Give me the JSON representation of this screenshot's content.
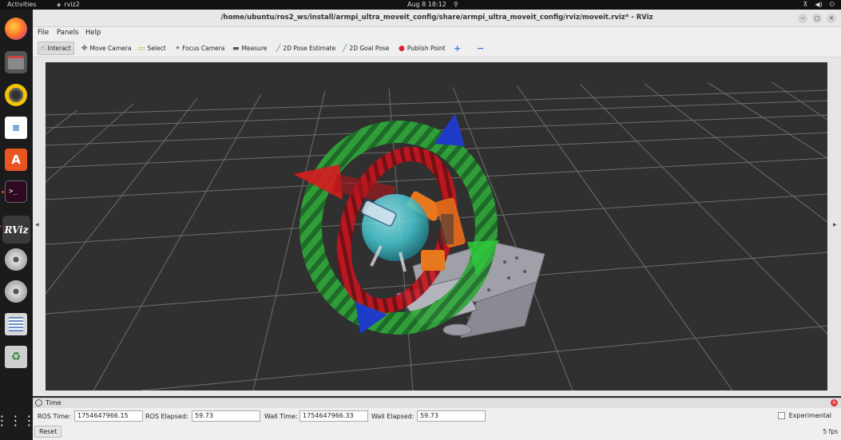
{
  "topbar": {
    "activities": "Activities",
    "app_name": "rviz2",
    "clock": "Aug 8  18:12"
  },
  "dock": {
    "writer_glyph": "≡",
    "appstore_glyph": "A",
    "terminal_glyph": ">_",
    "rviz_label": "RViz",
    "trash_glyph": "♻",
    "grid_glyph": "⋮⋮⋮"
  },
  "window": {
    "title": "/home/ubuntu/ros2_ws/install/armpi_ultra_moveit_config/share/armpi_ultra_moveit_config/rviz/moveit.rviz* - RViz"
  },
  "menu": {
    "file": "File",
    "panels": "Panels",
    "help": "Help"
  },
  "toolbar": {
    "interact": "Interact",
    "move_camera": "Move Camera",
    "select": "Select",
    "focus_camera": "Focus Camera",
    "measure": "Measure",
    "pose_estimate": "2D Pose Estimate",
    "goal_pose": "2D Goal Pose",
    "publish_point": "Publish Point",
    "add_tool": "+",
    "remove_tool": "−"
  },
  "time_panel": {
    "header": "Time",
    "ros_time_label": "ROS Time:",
    "ros_time": "1754647966.15",
    "ros_elapsed_label": "ROS Elapsed:",
    "ros_elapsed": "59.73",
    "wall_time_label": "Wall Time:",
    "wall_time": "1754647966.33",
    "wall_elapsed_label": "Wall Elapsed:",
    "wall_elapsed": "59.73",
    "experimental_label": "Experimental",
    "experimental_checked": false,
    "reset_label": "Reset",
    "fps": "5 fps"
  },
  "colors": {
    "viewport_bg": "#303030",
    "grid": "#6e6e6e",
    "ring_green": "#2fa83a",
    "ring_red": "#c8141e",
    "arrow_red": "#d21e1e",
    "arrow_blue": "#1e3cc8",
    "arm_orange": "#e8781e",
    "sphere_cyan": "#46c8d2",
    "base_gray": "#a0a0a8"
  }
}
